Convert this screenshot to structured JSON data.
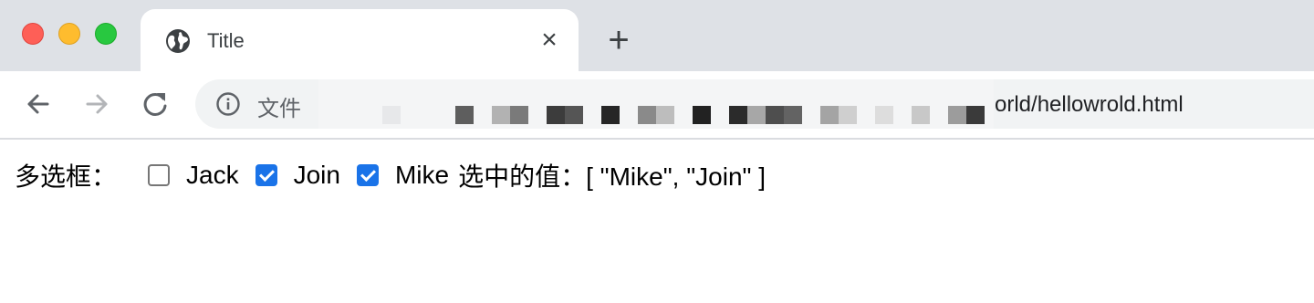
{
  "browser": {
    "tab": {
      "title": "Title",
      "close_label": "×",
      "icon": "globe-icon"
    },
    "new_tab_label": "+",
    "nav": {
      "back_icon": "arrow-left-icon",
      "forward_icon": "arrow-right-icon",
      "reload_icon": "reload-icon"
    },
    "omnibox": {
      "info_icon": "info-icon",
      "scheme_label": "文件",
      "url_visible_tail": "orld/hellowrold.html"
    }
  },
  "page": {
    "label": "多选框：",
    "options": [
      {
        "label": "Jack",
        "checked": false
      },
      {
        "label": "Join",
        "checked": true
      },
      {
        "label": "Mike",
        "checked": true
      }
    ],
    "selected_text": "选中的值：[ \"Mike\", \"Join\" ]"
  },
  "colors": {
    "tab_bar": "#dee1e6",
    "omnibox": "#f1f3f4",
    "checkbox_checked": "#1a73e8"
  }
}
